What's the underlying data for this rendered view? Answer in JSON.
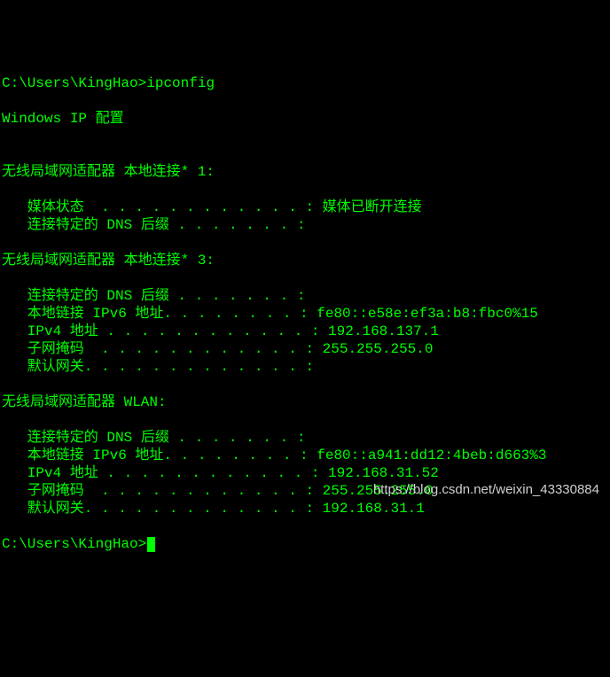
{
  "prompt1_path": "C:\\Users\\KingHao>",
  "command": "ipconfig",
  "blank": "",
  "header": "Windows IP 配置",
  "adapter1": {
    "title": "无线局域网适配器 本地连接* 1:",
    "media_line": "   媒体状态  . . . . . . . . . . . . : 媒体已断开连接",
    "dns_line": "   连接特定的 DNS 后缀 . . . . . . . :"
  },
  "adapter2": {
    "title": "无线局域网适配器 本地连接* 3:",
    "dns_line": "   连接特定的 DNS 后缀 . . . . . . . :",
    "ipv6_line": "   本地链接 IPv6 地址. . . . . . . . : fe80::e58e:ef3a:b8:fbc0%15",
    "ipv4_line": "   IPv4 地址 . . . . . . . . . . . . : 192.168.137.1",
    "mask_line": "   子网掩码  . . . . . . . . . . . . : 255.255.255.0",
    "gw_line": "   默认网关. . . . . . . . . . . . . :"
  },
  "adapter3": {
    "title": "无线局域网适配器 WLAN:",
    "dns_line": "   连接特定的 DNS 后缀 . . . . . . . :",
    "ipv6_line": "   本地链接 IPv6 地址. . . . . . . . : fe80::a941:dd12:4beb:d663%3",
    "ipv4_line": "   IPv4 地址 . . . . . . . . . . . . : 192.168.31.52",
    "mask_line": "   子网掩码  . . . . . . . . . . . . : 255.255.255.0",
    "gw_line": "   默认网关. . . . . . . . . . . . . : 192.168.31.1"
  },
  "prompt2_path": "C:\\Users\\KingHao>",
  "watermark": "https://blog.csdn.net/weixin_43330884"
}
